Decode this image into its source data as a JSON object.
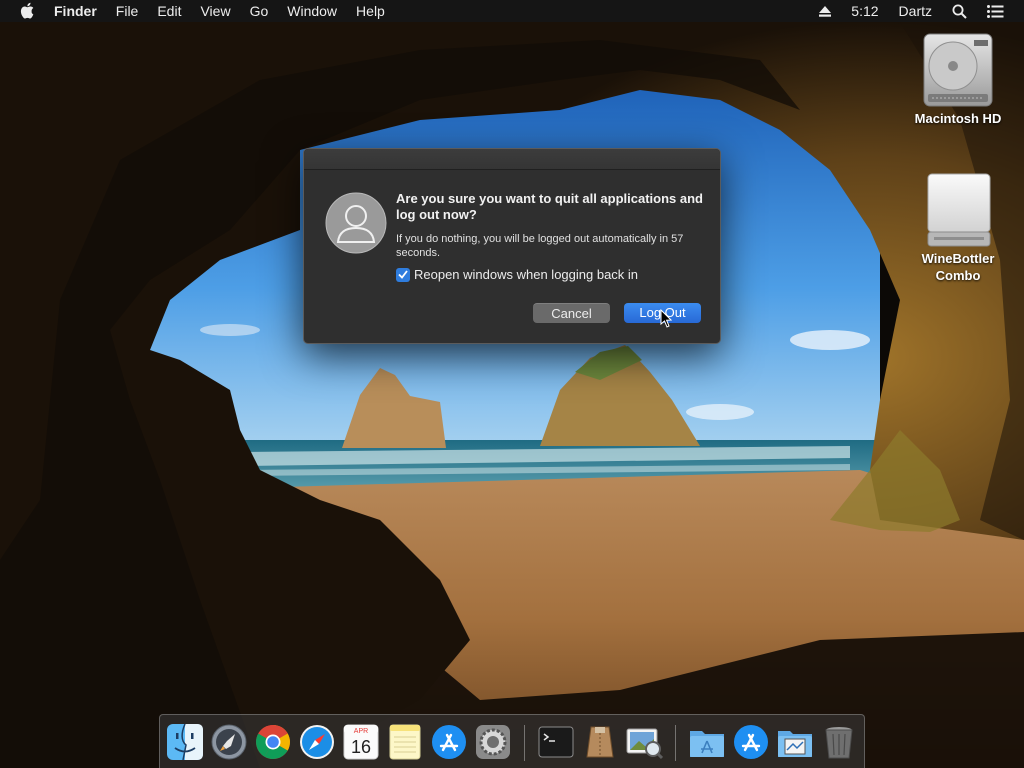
{
  "menubar": {
    "apple_icon": "apple-icon",
    "items": [
      "Finder",
      "File",
      "Edit",
      "View",
      "Go",
      "Window",
      "Help"
    ],
    "clock": "5:12",
    "user": "Dartz",
    "status_icons": [
      "eject-icon",
      "search-icon",
      "list-icon"
    ]
  },
  "desktop": {
    "icons": [
      {
        "label": "Macintosh HD",
        "icon": "hard-drive-icon"
      },
      {
        "label": "WineBottler Combo",
        "icon": "external-drive-icon"
      }
    ]
  },
  "dialog": {
    "title": "Are you sure you want to quit all applications and log out now?",
    "info": "If you do nothing, you will be logged out automatically in 57 seconds.",
    "checkbox_label": "Reopen windows when logging back in",
    "checkbox_checked": true,
    "cancel_label": "Cancel",
    "logout_label": "Log Out",
    "accent_color": "#2f7dde"
  },
  "dock": {
    "calendar": {
      "month": "APR",
      "day": "16"
    },
    "items": [
      "finder-icon",
      "launchpad-icon",
      "chrome-icon",
      "safari-icon",
      "calendar-icon",
      "notes-icon",
      "app-store-icon",
      "system-preferences-icon",
      "terminal-icon",
      "archive-utility-icon",
      "preview-icon",
      "applications-folder-icon",
      "app-store-icon",
      "downloads-folder-icon",
      "trash-icon"
    ]
  }
}
